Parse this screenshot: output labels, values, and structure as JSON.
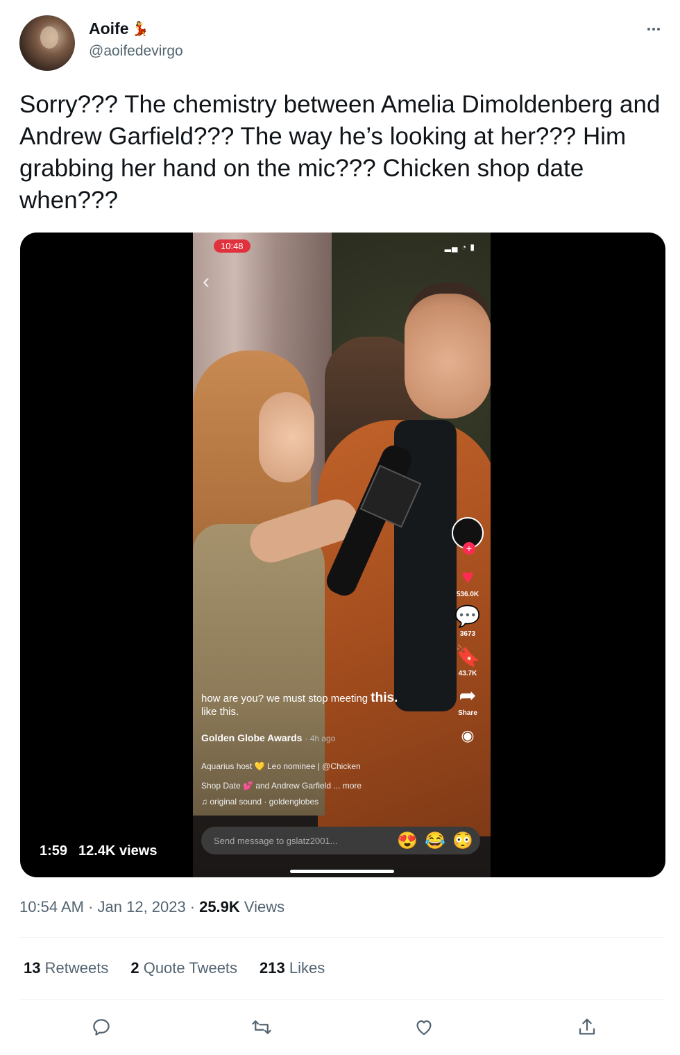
{
  "author": {
    "display_name": "Aoife",
    "name_emoji": "💃",
    "handle": "@aoifedevirgo"
  },
  "tweet": {
    "text": "Sorry??? The chemistry between Amelia Dimoldenberg and Andrew Garfield??? The way he’s looking at her??? Him grabbing her hand on the mic??? Chicken shop date when???"
  },
  "video": {
    "duration": "1:59",
    "views": "12.4K views",
    "screen": {
      "status_time": "10:48",
      "caption_small": "how are you? we must stop meeting",
      "caption_big": "this.",
      "caption_line2": "like this.",
      "account": "Golden Globe Awards",
      "account_ago": "· 4h ago",
      "desc_line1": "Aquarius host 💛 Leo nominee | @Chicken",
      "desc_line2": "Shop Date 💕 and Andrew Garfield ... more",
      "sound": "♫ original sound · goldenglobes",
      "likes_count": "536.0K",
      "comments_count": "3673",
      "saves_count": "43.7K",
      "share_label": "Share",
      "message_placeholder": "Send message to gslatz2001...",
      "reactions": [
        "😍",
        "😂",
        "😳"
      ]
    }
  },
  "meta": {
    "time": "10:54 AM",
    "date": "Jan 12, 2023",
    "views_count": "25.9K",
    "views_label": "Views"
  },
  "stats": {
    "retweets_count": "13",
    "retweets_label": "Retweets",
    "quotes_count": "2",
    "quotes_label": "Quote Tweets",
    "likes_count": "213",
    "likes_label": "Likes"
  },
  "colors": {
    "text": "#0f1419",
    "secondary": "#536471",
    "tiktok_red": "#fe2c55"
  }
}
